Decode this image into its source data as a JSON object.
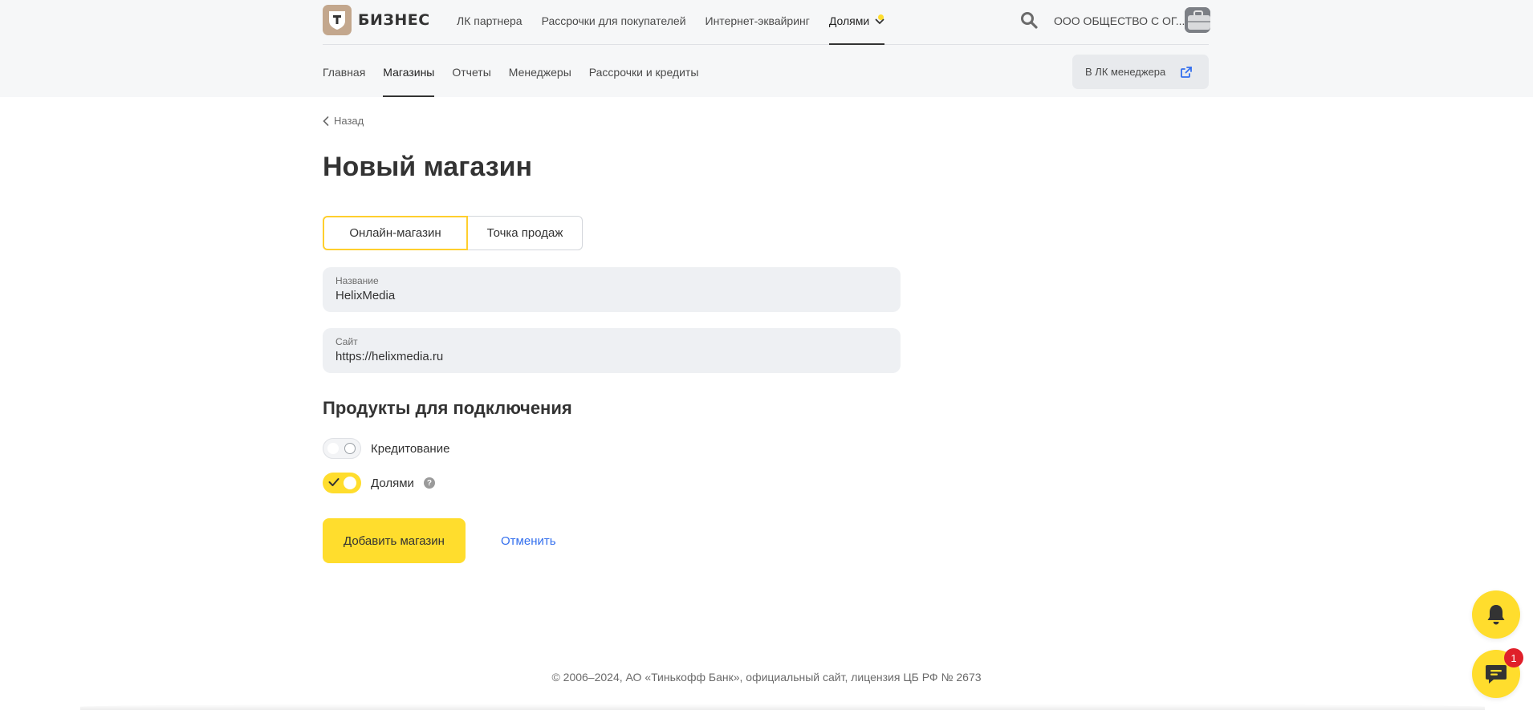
{
  "header": {
    "logo_text": "БИЗНЕС",
    "top_nav": [
      {
        "label": "ЛК партнера"
      },
      {
        "label": "Рассрочки для покупателей"
      },
      {
        "label": "Интернет-эквайринг"
      },
      {
        "label": "Долями"
      }
    ],
    "org_name": "ООО ОБЩЕСТВО С ОГ...",
    "sub_nav": [
      {
        "label": "Главная"
      },
      {
        "label": "Магазины"
      },
      {
        "label": "Отчеты"
      },
      {
        "label": "Менеджеры"
      },
      {
        "label": "Рассрочки и кредиты"
      }
    ],
    "manager_button": "В ЛК менеджера"
  },
  "main": {
    "back_label": "Назад",
    "title": "Новый магазин",
    "store_type": {
      "options": [
        "Онлайн-магазин",
        "Точка продаж"
      ],
      "selected": "Онлайн-магазин"
    },
    "name_field": {
      "label": "Название",
      "value": "HelixMedia"
    },
    "site_field": {
      "label": "Сайт",
      "value": "https://helixmedia.ru"
    },
    "products_title": "Продукты для подключения",
    "products": [
      {
        "label": "Кредитование",
        "enabled": false
      },
      {
        "label": "Долями",
        "enabled": true
      }
    ],
    "help_symbol": "?",
    "add_button": "Добавить магазин",
    "cancel_link": "Отменить"
  },
  "footer": {
    "copyright": "© 2006–2024, АО «Тинькофф Банк», официальный сайт, лицензия ЦБ РФ № 2673"
  },
  "chat": {
    "badge_count": "1"
  },
  "colors": {
    "accent": "#ffdd2d",
    "link": "#336fee",
    "badge": "#e0202a",
    "field_bg": "#eef0f3",
    "header_bg": "#f6f7f8"
  },
  "icons": [
    "logo-shield-icon",
    "chevron-down-icon",
    "search-icon",
    "briefcase-icon",
    "chevron-left-icon",
    "external-link-icon",
    "check-icon",
    "help-icon",
    "bell-icon",
    "chat-icon"
  ]
}
